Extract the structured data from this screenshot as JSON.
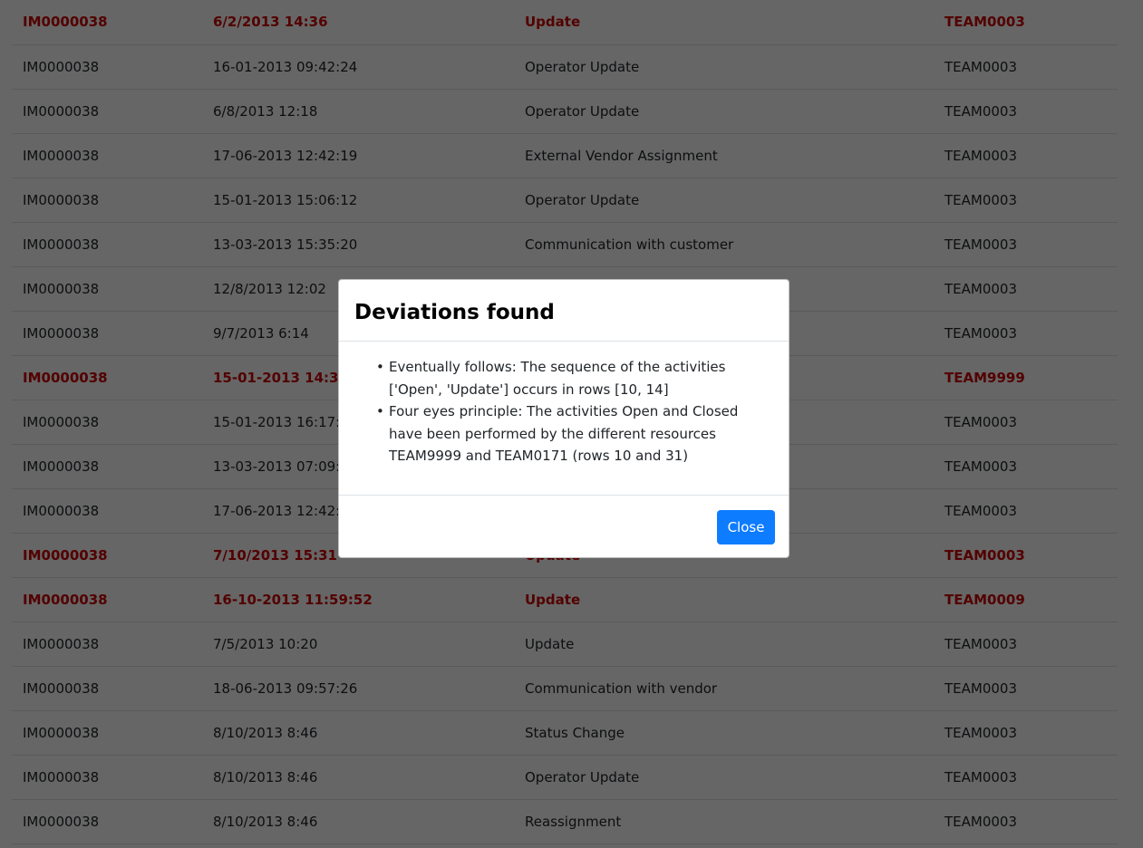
{
  "table": {
    "rows": [
      {
        "case": "IM0000038",
        "time": "6/2/2013 14:36",
        "activity": "Update",
        "resource": "TEAM0003",
        "deviation": true
      },
      {
        "case": "IM0000038",
        "time": "16-01-2013 09:42:24",
        "activity": "Operator Update",
        "resource": "TEAM0003",
        "deviation": false
      },
      {
        "case": "IM0000038",
        "time": "6/8/2013 12:18",
        "activity": "Operator Update",
        "resource": "TEAM0003",
        "deviation": false
      },
      {
        "case": "IM0000038",
        "time": "17-06-2013 12:42:19",
        "activity": "External Vendor Assignment",
        "resource": "TEAM0003",
        "deviation": false
      },
      {
        "case": "IM0000038",
        "time": "15-01-2013 15:06:12",
        "activity": "Operator Update",
        "resource": "TEAM0003",
        "deviation": false
      },
      {
        "case": "IM0000038",
        "time": "13-03-2013 15:35:20",
        "activity": "Communication with customer",
        "resource": "TEAM0003",
        "deviation": false
      },
      {
        "case": "IM0000038",
        "time": "12/8/2013 12:02",
        "activity": "",
        "resource": "TEAM0003",
        "deviation": false
      },
      {
        "case": "IM0000038",
        "time": "9/7/2013 6:14",
        "activity": "",
        "resource": "TEAM0003",
        "deviation": false
      },
      {
        "case": "IM0000038",
        "time": "15-01-2013 14:36:33",
        "activity": "",
        "resource": "TEAM9999",
        "deviation": true
      },
      {
        "case": "IM0000038",
        "time": "15-01-2013 16:17:52",
        "activity": "",
        "resource": "TEAM0003",
        "deviation": false
      },
      {
        "case": "IM0000038",
        "time": "13-03-2013 07:09:42",
        "activity": "",
        "resource": "TEAM0003",
        "deviation": false
      },
      {
        "case": "IM0000038",
        "time": "17-06-2013 12:42:19",
        "activity": "",
        "resource": "TEAM0003",
        "deviation": false
      },
      {
        "case": "IM0000038",
        "time": "7/10/2013 15:31",
        "activity": "Update",
        "resource": "TEAM0003",
        "deviation": true
      },
      {
        "case": "IM0000038",
        "time": "16-10-2013 11:59:52",
        "activity": "Update",
        "resource": "TEAM0009",
        "deviation": true
      },
      {
        "case": "IM0000038",
        "time": "7/5/2013 10:20",
        "activity": "Update",
        "resource": "TEAM0003",
        "deviation": false
      },
      {
        "case": "IM0000038",
        "time": "18-06-2013 09:57:26",
        "activity": "Communication with vendor",
        "resource": "TEAM0003",
        "deviation": false
      },
      {
        "case": "IM0000038",
        "time": "8/10/2013 8:46",
        "activity": "Status Change",
        "resource": "TEAM0003",
        "deviation": false
      },
      {
        "case": "IM0000038",
        "time": "8/10/2013 8:46",
        "activity": "Operator Update",
        "resource": "TEAM0003",
        "deviation": false
      },
      {
        "case": "IM0000038",
        "time": "8/10/2013 8:46",
        "activity": "Reassignment",
        "resource": "TEAM0003",
        "deviation": false
      }
    ]
  },
  "modal": {
    "title": "Deviations found",
    "items": [
      "Eventually follows: The sequence of the activities ['Open', 'Update'] occurs in rows [10, 14]",
      "Four eyes principle: The activities Open and Closed have been performed by the different resources TEAM9999 and TEAM0171 (rows 10 and 31)"
    ],
    "close_label": "Close"
  },
  "colors": {
    "deviation_text": "#d00000",
    "primary_button": "#0d7cff",
    "backdrop": "rgba(0,0,0,0.6)"
  }
}
